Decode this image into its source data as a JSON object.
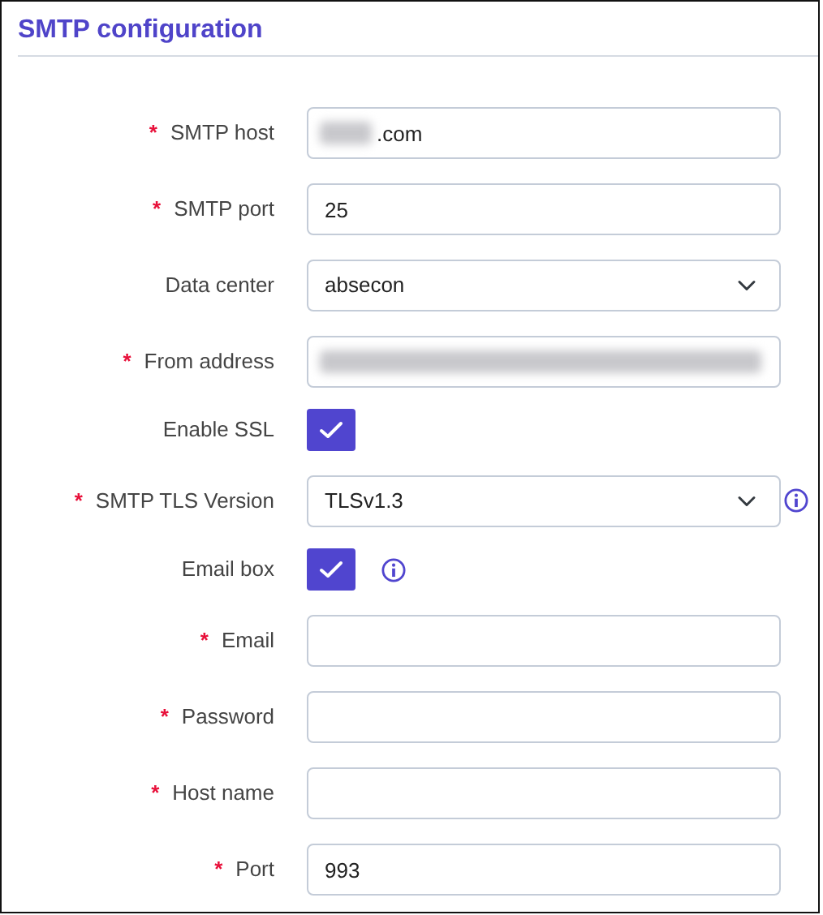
{
  "section": {
    "title": "SMTP configuration"
  },
  "fields": [
    {
      "kind": "input",
      "asterisk": "*",
      "label": "SMTP host",
      "value": ".com",
      "redacted": true
    },
    {
      "kind": "input",
      "asterisk": "*",
      "label": "SMTP port",
      "value": "25"
    },
    {
      "kind": "select",
      "label": "Data center",
      "value": "absecon"
    },
    {
      "kind": "input",
      "asterisk": "*",
      "label": "From address",
      "redacted": true
    },
    {
      "kind": "checkbox",
      "label": "Enable SSL",
      "checked": true,
      "info": false
    },
    {
      "kind": "select",
      "asterisk": "*",
      "label": "SMTP TLS Version",
      "value": "TLSv1.3",
      "info": true
    },
    {
      "kind": "checkbox",
      "label": "Email box",
      "checked": true,
      "info": true
    },
    {
      "kind": "input",
      "asterisk": "*",
      "label": "Email"
    },
    {
      "kind": "input",
      "asterisk": "*",
      "label": "Password"
    },
    {
      "kind": "input",
      "asterisk": "*",
      "label": "Host name"
    },
    {
      "kind": "input",
      "asterisk": "*",
      "label": "Port",
      "value": "993"
    }
  ]
}
